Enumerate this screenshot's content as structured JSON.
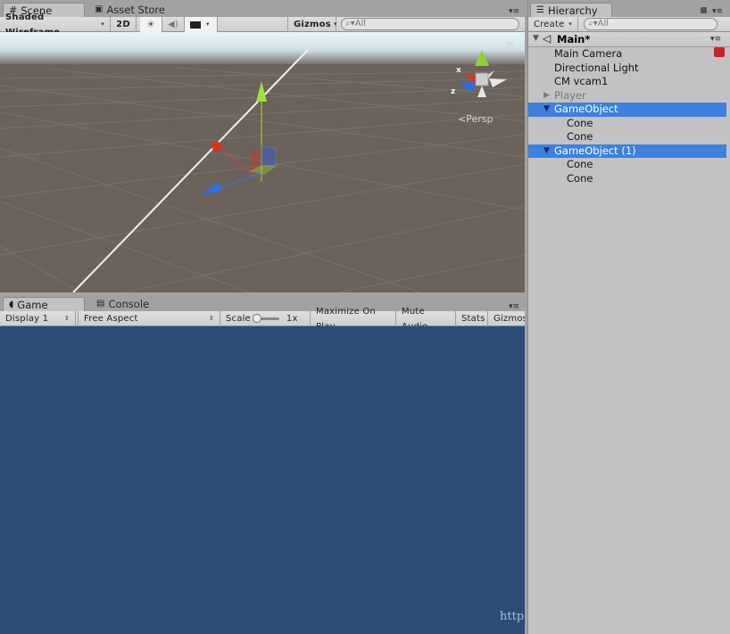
{
  "scene_panel": {
    "tabs": [
      {
        "label": "Scene",
        "icon": "grid-icon",
        "active": true
      },
      {
        "label": "Asset Store",
        "icon": "shopping-bag-icon",
        "active": false
      }
    ],
    "toolbar": {
      "draw_mode": "Shaded Wireframe",
      "toggle_2d": "2D",
      "lighting_icon": "sun-icon",
      "audio_icon": "speaker-icon",
      "effects_icon": "image-icon",
      "gizmos": "Gizmos",
      "search_placeholder": "All"
    },
    "view": {
      "projection_label": "Persp",
      "orientation_gizmo_axes": [
        "x",
        "y",
        "z"
      ],
      "axis_colors": {
        "x": "#e0301c",
        "y": "#8ed22a",
        "z": "#2f6de6"
      }
    }
  },
  "game_panel": {
    "tabs": [
      {
        "label": "Game",
        "icon": "pacman-icon",
        "active": true
      },
      {
        "label": "Console",
        "icon": "console-icon",
        "active": false
      }
    ],
    "toolbar": {
      "display": "Display 1",
      "aspect": "Free Aspect",
      "scale_label": "Scale",
      "scale_value": "1x",
      "maximize_on_play": "Maximize On Play",
      "mute_audio": "Mute Audio",
      "stats": "Stats",
      "gizmos": "Gizmos"
    },
    "background_color": "#2c4c78"
  },
  "hierarchy_panel": {
    "tab": {
      "label": "Hierarchy",
      "icon": "list-icon"
    },
    "create_label": "Create",
    "search_placeholder": "All",
    "scene_name": "Main*",
    "items": [
      {
        "label": "Main Camera",
        "depth": 1,
        "selected": false,
        "expand": "none",
        "dimmed": false
      },
      {
        "label": "Directional Light",
        "depth": 1,
        "selected": false,
        "expand": "none",
        "dimmed": false
      },
      {
        "label": "CM vcam1",
        "depth": 1,
        "selected": false,
        "expand": "none",
        "dimmed": false
      },
      {
        "label": "Player",
        "depth": 1,
        "selected": false,
        "expand": "collapsed",
        "dimmed": true
      },
      {
        "label": "GameObject",
        "depth": 1,
        "selected": true,
        "expand": "expanded",
        "dimmed": false
      },
      {
        "label": "Cone",
        "depth": 2,
        "selected": false,
        "expand": "none",
        "dimmed": false
      },
      {
        "label": "Cone",
        "depth": 2,
        "selected": false,
        "expand": "none",
        "dimmed": false
      },
      {
        "label": "GameObject (1)",
        "depth": 1,
        "selected": true,
        "expand": "expanded",
        "dimmed": false
      },
      {
        "label": "Cone",
        "depth": 2,
        "selected": false,
        "expand": "none",
        "dimmed": false
      },
      {
        "label": "Cone",
        "depth": 2,
        "selected": false,
        "expand": "none",
        "dimmed": false
      }
    ],
    "selection_color": "#3d80df"
  },
  "watermark": "http"
}
